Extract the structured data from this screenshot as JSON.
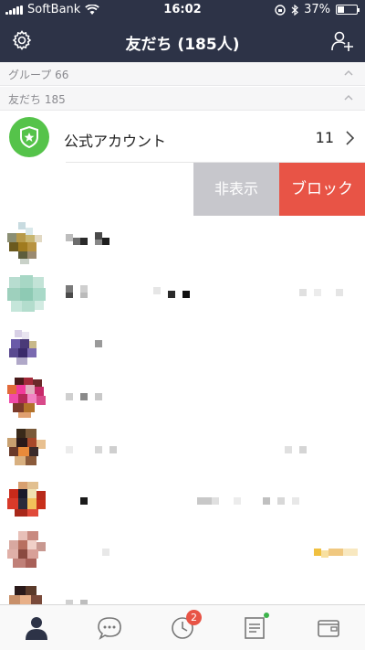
{
  "status_bar": {
    "carrier": "SoftBank",
    "time": "16:02",
    "battery_percent": "37%",
    "battery_level": 0.37
  },
  "nav": {
    "title": "友だち (185人)",
    "left_icon": "gear-icon",
    "right_icon": "add-friend-icon"
  },
  "sections": [
    {
      "label": "グループ 66"
    },
    {
      "label": "友だち 185"
    }
  ],
  "official_account": {
    "label": "公式アカウント",
    "count": "11",
    "icon": "shield-star-icon"
  },
  "swipe_actions": {
    "hide_label": "非表示",
    "block_label": "ブロック"
  },
  "tabbar": {
    "items": [
      {
        "name": "friends",
        "icon": "person-icon",
        "active": true
      },
      {
        "name": "chats",
        "icon": "chat-bubble-icon"
      },
      {
        "name": "timeline",
        "icon": "clock-icon",
        "badge": "2"
      },
      {
        "name": "news",
        "icon": "news-icon",
        "dot": true
      },
      {
        "name": "wallet",
        "icon": "wallet-icon"
      }
    ]
  },
  "colors": {
    "header_bg": "#2d3347",
    "official_green": "#55c34a",
    "hide_gray": "#c7c7cc",
    "block_red": "#e85446",
    "badge_red": "#e85446",
    "dot_green": "#3bb34a"
  }
}
